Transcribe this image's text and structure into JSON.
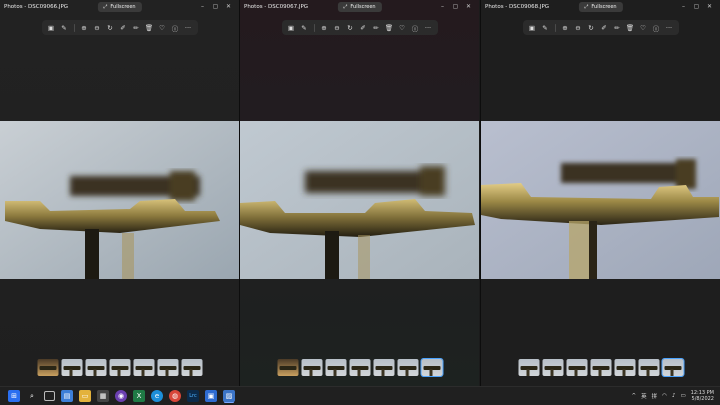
{
  "windows": [
    {
      "title": "Photos - DSC09066.JPG",
      "fullscreen_label": "Fullscreen",
      "thumbnails": 7,
      "selected_thumbnail": 0
    },
    {
      "title": "Photos - DSC09067.JPG",
      "fullscreen_label": "Fullscreen",
      "thumbnails": 7,
      "selected_thumbnail": 6
    },
    {
      "title": "Photos - DSC09068.JPG",
      "fullscreen_label": "Fullscreen",
      "thumbnails": 7,
      "selected_thumbnail": 6
    }
  ],
  "toolbar_icons": [
    "crop-icon",
    "edit-icon",
    "zoom-in-icon",
    "zoom-out-icon",
    "rotate-icon",
    "markup-icon",
    "draw-icon",
    "delete-icon",
    "favorite-icon",
    "info-icon",
    "more-icon"
  ],
  "window_controls": [
    "minimize-icon",
    "maximize-icon",
    "close-icon"
  ],
  "taskbar": {
    "icons": [
      "windows-start-icon",
      "search-icon",
      "task-view-icon",
      "widgets-icon",
      "file-explorer-icon",
      "store-icon",
      "photos-icon",
      "excel-icon",
      "edge-icon",
      "chrome-icon",
      "lightroom-icon",
      "app-icon",
      "photos-app-icon"
    ],
    "tray_lang_1": "英",
    "tray_lang_2": "拼",
    "time": "12:13 PM",
    "date": "5/8/2022"
  },
  "colors": {
    "accent": "#4aa3ff",
    "brass": "#b9a15f",
    "background": "#1f1f1f"
  }
}
